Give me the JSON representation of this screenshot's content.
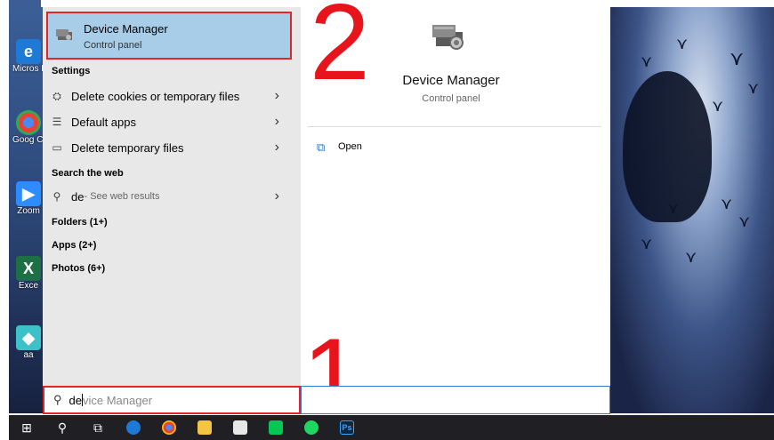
{
  "top_result": {
    "title": "Device Manager",
    "subtitle": "Control panel"
  },
  "settings": {
    "header": "Settings",
    "items": [
      {
        "label": "Delete cookies or temporary files",
        "icon": "cookies-icon"
      },
      {
        "label": "Default apps",
        "icon": "list-icon"
      },
      {
        "label": "Delete temporary files",
        "icon": "drive-icon"
      }
    ]
  },
  "web": {
    "header": "Search the web",
    "query": "de",
    "suffix": " - See web results"
  },
  "groups": [
    "Folders (1+)",
    "Apps (2+)",
    "Photos (6+)"
  ],
  "detail": {
    "title": "Device Manager",
    "subtitle": "Control panel",
    "action": "Open"
  },
  "search": {
    "typed": "de",
    "autocomplete": "vice Manager"
  },
  "annotations": {
    "one": "1",
    "two": "2"
  },
  "desktop_icons": [
    "Micros Edge",
    "Goog Chron",
    "Zoom",
    "Exce",
    "aa"
  ],
  "taskbar_labels": {
    "ps": "Ps"
  },
  "colors": {
    "highlight": "#a8cde8",
    "annotation": "#e0262b",
    "accent": "#2a7fd4"
  }
}
